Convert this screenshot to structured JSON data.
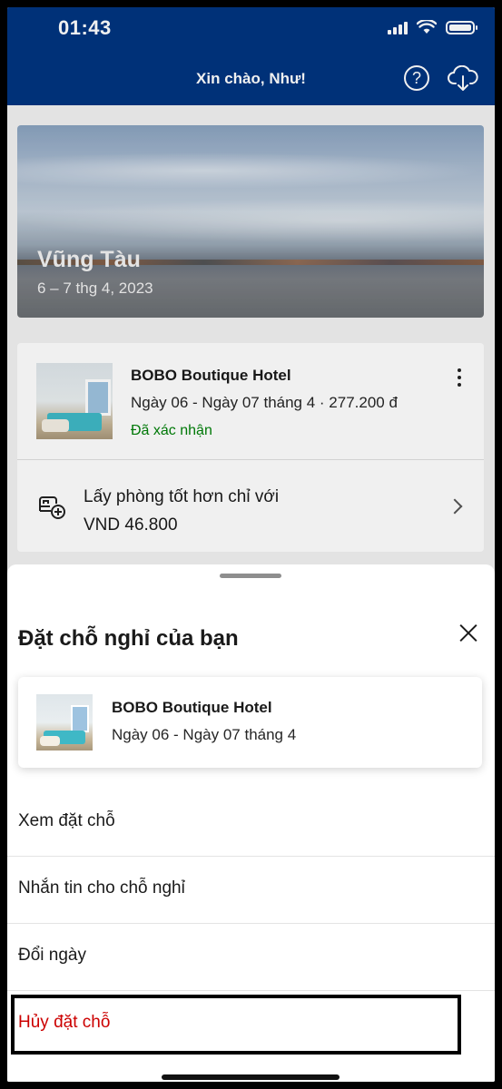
{
  "status_bar": {
    "time": "01:43"
  },
  "header": {
    "greeting": "Xin chào, Như!"
  },
  "trip": {
    "city": "Vũng Tàu",
    "dates": "6 – 7 thg 4, 2023"
  },
  "booking": {
    "hotel_name": "BOBO Boutique Hotel",
    "detail": "Ngày 06 - Ngày 07 tháng 4 · 277.200 đ",
    "status": "Đã xác nhận",
    "status_color": "#008009"
  },
  "upgrade": {
    "line1": "Lấy phòng tốt hơn chỉ với",
    "line2": "VND 46.800"
  },
  "sheet": {
    "title": "Đặt chỗ nghỉ của bạn",
    "hotel_name": "BOBO Boutique Hotel",
    "hotel_dates": "Ngày 06 - Ngày 07 tháng 4",
    "menu": [
      {
        "label": "Xem đặt chỗ"
      },
      {
        "label": "Nhắn tin cho chỗ nghỉ"
      },
      {
        "label": "Đổi ngày"
      },
      {
        "label": "Hủy đặt chỗ"
      }
    ]
  },
  "colors": {
    "brand": "#003580",
    "danger": "#cc0000"
  }
}
